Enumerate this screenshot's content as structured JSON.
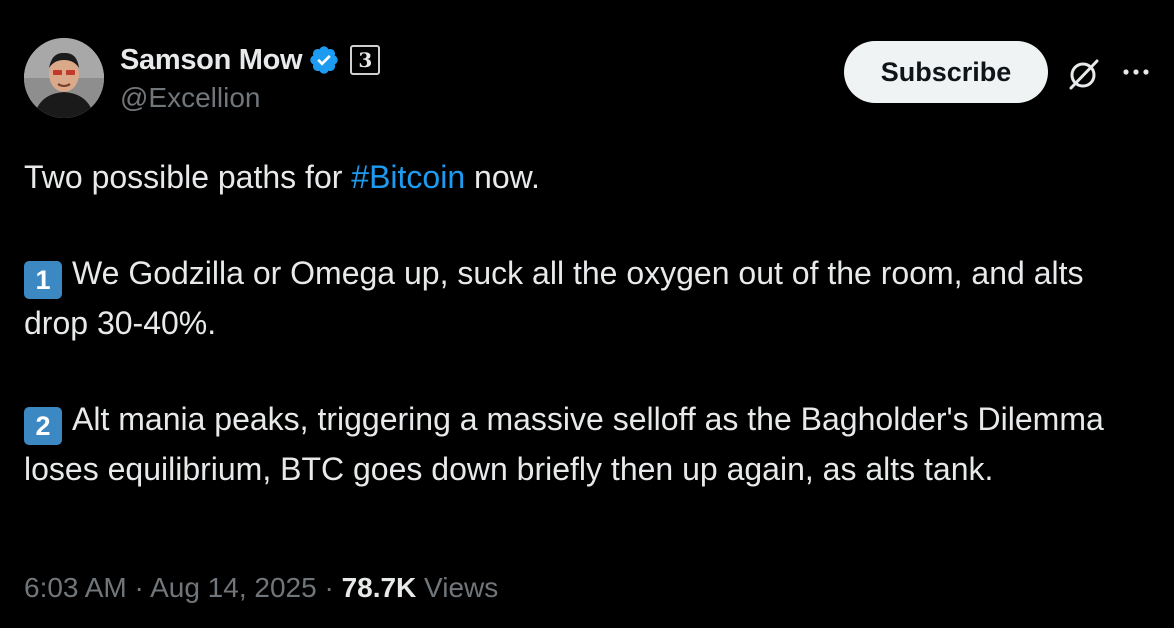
{
  "author": {
    "display_name": "Samson Mow",
    "handle": "@Excellion",
    "affiliate_badge": "3",
    "verified_color": "#1d9bf0"
  },
  "actions": {
    "subscribe_label": "Subscribe",
    "grok_icon": "grok-icon",
    "more_icon": "more-icon"
  },
  "tweet": {
    "intro_before": "Two possible paths for ",
    "hashtag": "#Bitcoin",
    "intro_after": " now.",
    "point1_key": "1",
    "point1_text": "We Godzilla or Omega up, suck all the oxygen out of the room, and alts drop 30-40%.",
    "point2_key": "2",
    "point2_text": "Alt mania peaks, triggering a massive selloff as the Bagholder's Dilemma loses equilibrium, BTC goes down briefly then up again, as alts tank."
  },
  "meta": {
    "time": "6:03 AM",
    "sep1": " · ",
    "date": "Aug 14, 2025",
    "sep2": " · ",
    "views_count": "78.7K",
    "views_label": " Views"
  },
  "colors": {
    "background": "#000000",
    "text": "#e7e9ea",
    "secondary": "#71767b",
    "link": "#1d9bf0",
    "keycap": "#3b88c3"
  }
}
